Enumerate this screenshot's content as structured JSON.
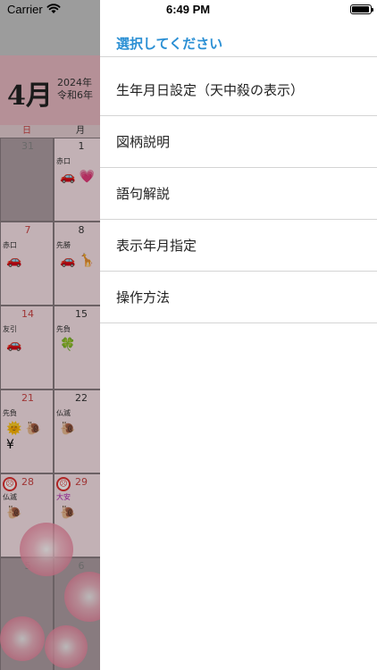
{
  "status_bar": {
    "carrier": "Carrier",
    "time": "6:49 PM"
  },
  "calendar": {
    "month": "4月",
    "year": "2024年",
    "era": "令和6年",
    "weekdays": [
      "日",
      "月"
    ],
    "weeks": [
      [
        {
          "day": "31",
          "rokuyo": "",
          "icons": ""
        },
        {
          "day": "1",
          "rokuyo": "赤口",
          "icons": "🚗 💗"
        }
      ],
      [
        {
          "day": "7",
          "rokuyo": "赤口",
          "icons": "🚗"
        },
        {
          "day": "8",
          "rokuyo": "先勝",
          "icons": "🚗 🦒"
        }
      ],
      [
        {
          "day": "14",
          "rokuyo": "友引",
          "icons": "🚗"
        },
        {
          "day": "15",
          "rokuyo": "先負",
          "icons": "🍀"
        }
      ],
      [
        {
          "day": "21",
          "rokuyo": "先負",
          "icons": "🌞 🐌 ¥"
        },
        {
          "day": "22",
          "rokuyo": "仏滅",
          "icons": "🐌"
        }
      ],
      [
        {
          "day": "28",
          "rokuyo": "仏滅",
          "icons": "🐌"
        },
        {
          "day": "29",
          "rokuyo": "大安",
          "icons": "🐌"
        }
      ],
      [
        {
          "day": "5",
          "rokuyo": "",
          "icons": ""
        },
        {
          "day": "6",
          "rokuyo": "",
          "icons": ""
        }
      ]
    ]
  },
  "drawer": {
    "title": "選択してください",
    "items": [
      {
        "label": "生年月日設定（天中殺の表示）"
      },
      {
        "label": "図柄説明"
      },
      {
        "label": "語句解説"
      },
      {
        "label": "表示年月指定"
      },
      {
        "label": "操作方法"
      }
    ]
  }
}
